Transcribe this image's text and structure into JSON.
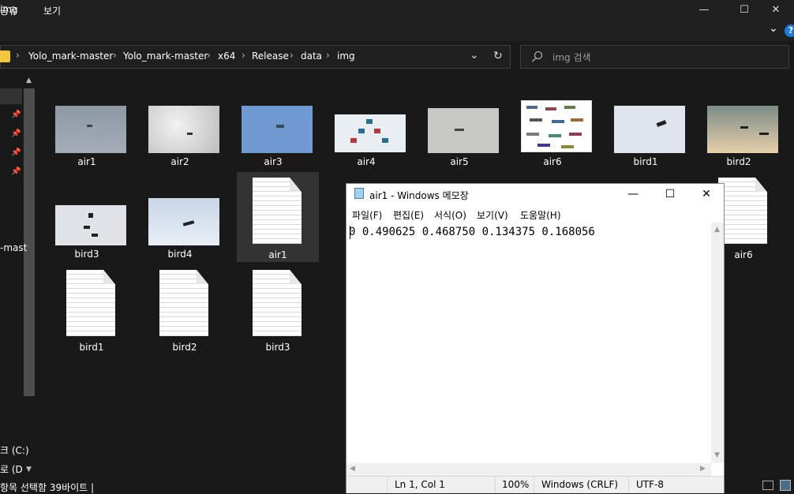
{
  "window": {
    "title": "img",
    "minimize": "—",
    "maximize": "☐",
    "close": "✕"
  },
  "ribbon": {
    "tabs": [
      "공유",
      "보기"
    ],
    "expand": "⌄",
    "help": "?"
  },
  "address": {
    "crumbs": [
      "Yolo_mark-master",
      "Yolo_mark-master",
      "x64",
      "Release",
      "data",
      "img"
    ],
    "sep": "›",
    "dropdown": "⌄",
    "refresh": "↻"
  },
  "search": {
    "placeholder": "img 검색"
  },
  "nav": {
    "items": [
      "-mast",
      "크 (C:)",
      "로 (D"
    ]
  },
  "files": [
    {
      "name": "air1",
      "kind": "image"
    },
    {
      "name": "air2",
      "kind": "image"
    },
    {
      "name": "air3",
      "kind": "image"
    },
    {
      "name": "air4",
      "kind": "image"
    },
    {
      "name": "air5",
      "kind": "image"
    },
    {
      "name": "air6",
      "kind": "image"
    },
    {
      "name": "bird1",
      "kind": "image"
    },
    {
      "name": "bird2",
      "kind": "image"
    },
    {
      "name": "bird3",
      "kind": "image"
    },
    {
      "name": "bird4",
      "kind": "image"
    },
    {
      "name": "air1",
      "kind": "text",
      "selected": true
    },
    {
      "name": "air6",
      "kind": "text"
    },
    {
      "name": "bird1",
      "kind": "text"
    },
    {
      "name": "bird2",
      "kind": "text"
    },
    {
      "name": "bird3",
      "kind": "text"
    }
  ],
  "status": {
    "text": "항목 선택함 39바이트 |"
  },
  "notepad": {
    "title": "air1 - Windows 메모장",
    "menu": [
      "파일(F)",
      "편집(E)",
      "서식(O)",
      "보기(V)",
      "도움말(H)"
    ],
    "content": "0 0.490625 0.468750 0.134375 0.168056",
    "status": {
      "position": "Ln 1, Col 1",
      "zoom": "100%",
      "line_ending": "Windows (CRLF)",
      "encoding": "UTF-8"
    },
    "min": "—",
    "max": "☐",
    "close": "✕"
  },
  "colors": {
    "folder": "#f3c63f",
    "help": "#1e7ad6",
    "selection": "#333333"
  }
}
